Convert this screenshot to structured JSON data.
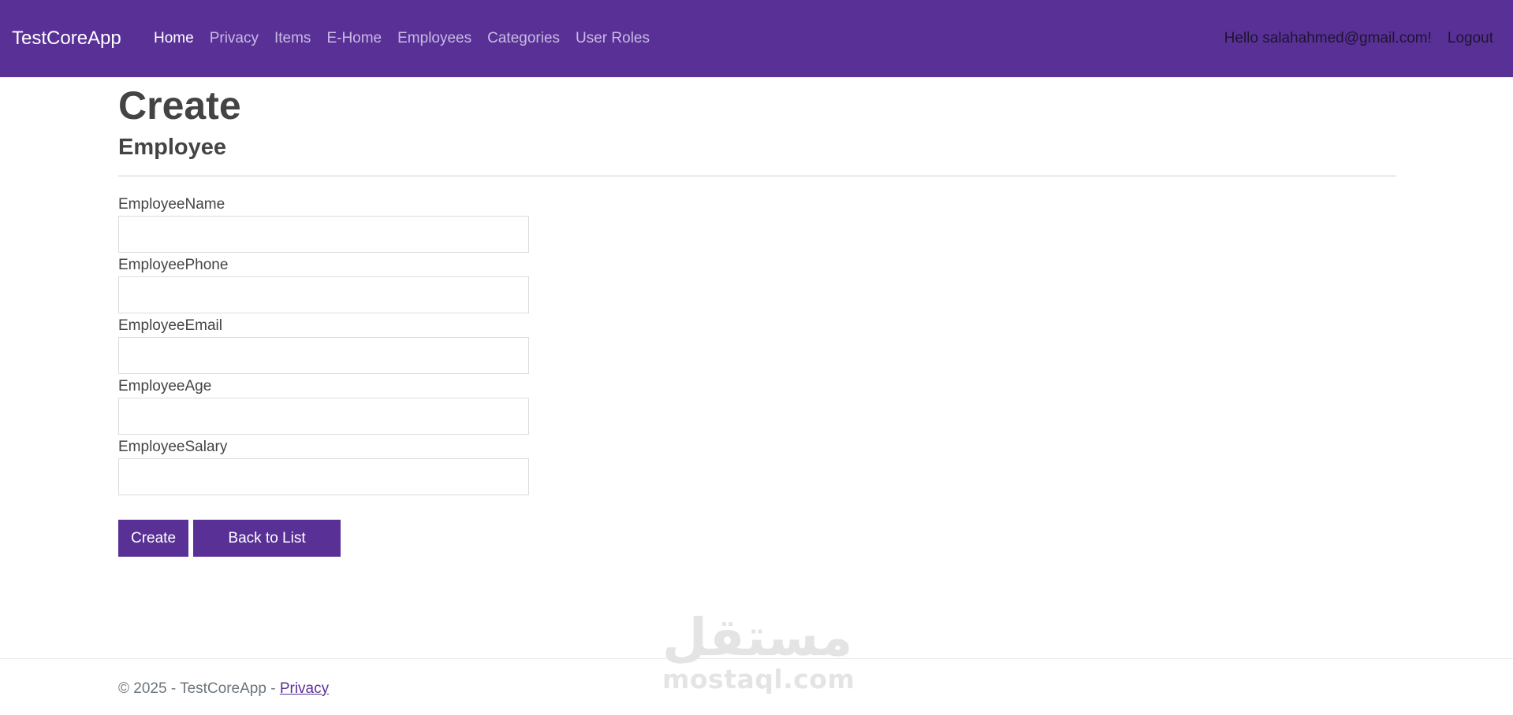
{
  "navbar": {
    "brand": "TestCoreApp",
    "links": [
      {
        "label": "Home",
        "active": true
      },
      {
        "label": "Privacy"
      },
      {
        "label": "Items"
      },
      {
        "label": "E-Home"
      },
      {
        "label": "Employees"
      },
      {
        "label": "Categories"
      },
      {
        "label": "User Roles"
      }
    ],
    "greeting": "Hello salahahmed@gmail.com!",
    "logout_label": "Logout",
    "background_color": "#593196"
  },
  "page": {
    "title": "Create",
    "subtitle": "Employee"
  },
  "form": {
    "fields": [
      {
        "label": "EmployeeName",
        "value": ""
      },
      {
        "label": "EmployeePhone",
        "value": ""
      },
      {
        "label": "EmployeeEmail",
        "value": ""
      },
      {
        "label": "EmployeeAge",
        "value": ""
      },
      {
        "label": "EmployeeSalary",
        "value": ""
      }
    ],
    "create_label": "Create",
    "back_label": "Back to List"
  },
  "watermark": {
    "arabic": "مستقل",
    "latin": "mostaql.com"
  },
  "footer": {
    "text": "© 2025 - TestCoreApp - ",
    "privacy_label": "Privacy"
  },
  "colors": {
    "accent": "#593196",
    "nav_inactive": "#c9b9e2",
    "text": "#444444"
  }
}
